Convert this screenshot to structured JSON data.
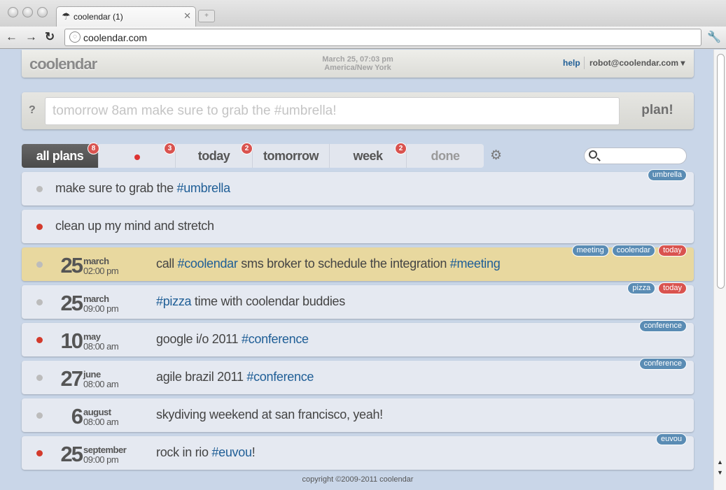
{
  "browser": {
    "tab_title": "coolendar (1)",
    "url": "coolendar.com"
  },
  "header": {
    "logo": "coolendar",
    "date": "March 25, 07:03 pm",
    "timezone": "America/New York",
    "help": "help",
    "user": "robot@coolendar.com ▾"
  },
  "quickadd": {
    "help": "?",
    "placeholder": "tomorrow 8am make sure to grab the #umbrella!",
    "button": "plan!"
  },
  "filters": [
    {
      "label": "all plans",
      "badge": "8"
    },
    {
      "label": "",
      "badge": "3"
    },
    {
      "label": "today",
      "badge": "2"
    },
    {
      "label": "tomorrow",
      "badge": ""
    },
    {
      "label": "week",
      "badge": "2"
    },
    {
      "label": "done",
      "badge": ""
    }
  ],
  "plans": [
    {
      "priority": "normal",
      "day": "",
      "month": "",
      "time": "",
      "text": "make sure to grab the ",
      "hashtags": "#umbrella",
      "text_after": "",
      "labels": [
        "umbrella"
      ]
    },
    {
      "priority": "urgent",
      "day": "",
      "month": "",
      "time": "",
      "text": "clean up my mind and stretch",
      "hashtags": "",
      "text_after": "",
      "labels": []
    },
    {
      "priority": "normal",
      "day": "25",
      "month": "march",
      "time": "02:00 pm",
      "text": "call ",
      "hashtags": "#coolendar",
      "text_after": " sms broker to schedule the integration ",
      "hashtags2": "#meeting",
      "labels": [
        "meeting",
        "coolendar",
        "today"
      ]
    },
    {
      "priority": "normal",
      "day": "25",
      "month": "march",
      "time": "09:00 pm",
      "text": "",
      "hashtags": "#pizza",
      "text_after": " time with coolendar buddies",
      "labels": [
        "pizza",
        "today"
      ]
    },
    {
      "priority": "urgent",
      "day": "10",
      "month": "may",
      "time": "08:00 am",
      "text": "google i/o 2011 ",
      "hashtags": "#conference",
      "text_after": "",
      "labels": [
        "conference"
      ]
    },
    {
      "priority": "normal",
      "day": "27",
      "month": "june",
      "time": "08:00 am",
      "text": "agile brazil 2011 ",
      "hashtags": "#conference",
      "text_after": "",
      "labels": [
        "conference"
      ]
    },
    {
      "priority": "normal",
      "day": "6",
      "month": "august",
      "time": "08:00 am",
      "text": "skydiving weekend at san francisco, yeah!",
      "hashtags": "",
      "text_after": "",
      "labels": []
    },
    {
      "priority": "urgent",
      "day": "25",
      "month": "september",
      "time": "09:00 pm",
      "text": "rock in rio ",
      "hashtags": "#euvou",
      "text_after": "!",
      "labels": [
        "euvou"
      ]
    }
  ],
  "footer": {
    "copyright": "copyright ©2009-2011 coolendar"
  },
  "colors": {
    "background": "#c9d6e8",
    "link": "#1f5e96",
    "label": "#5a8cb4",
    "today_label": "#d9534f",
    "highlight": "#e8d89f"
  }
}
